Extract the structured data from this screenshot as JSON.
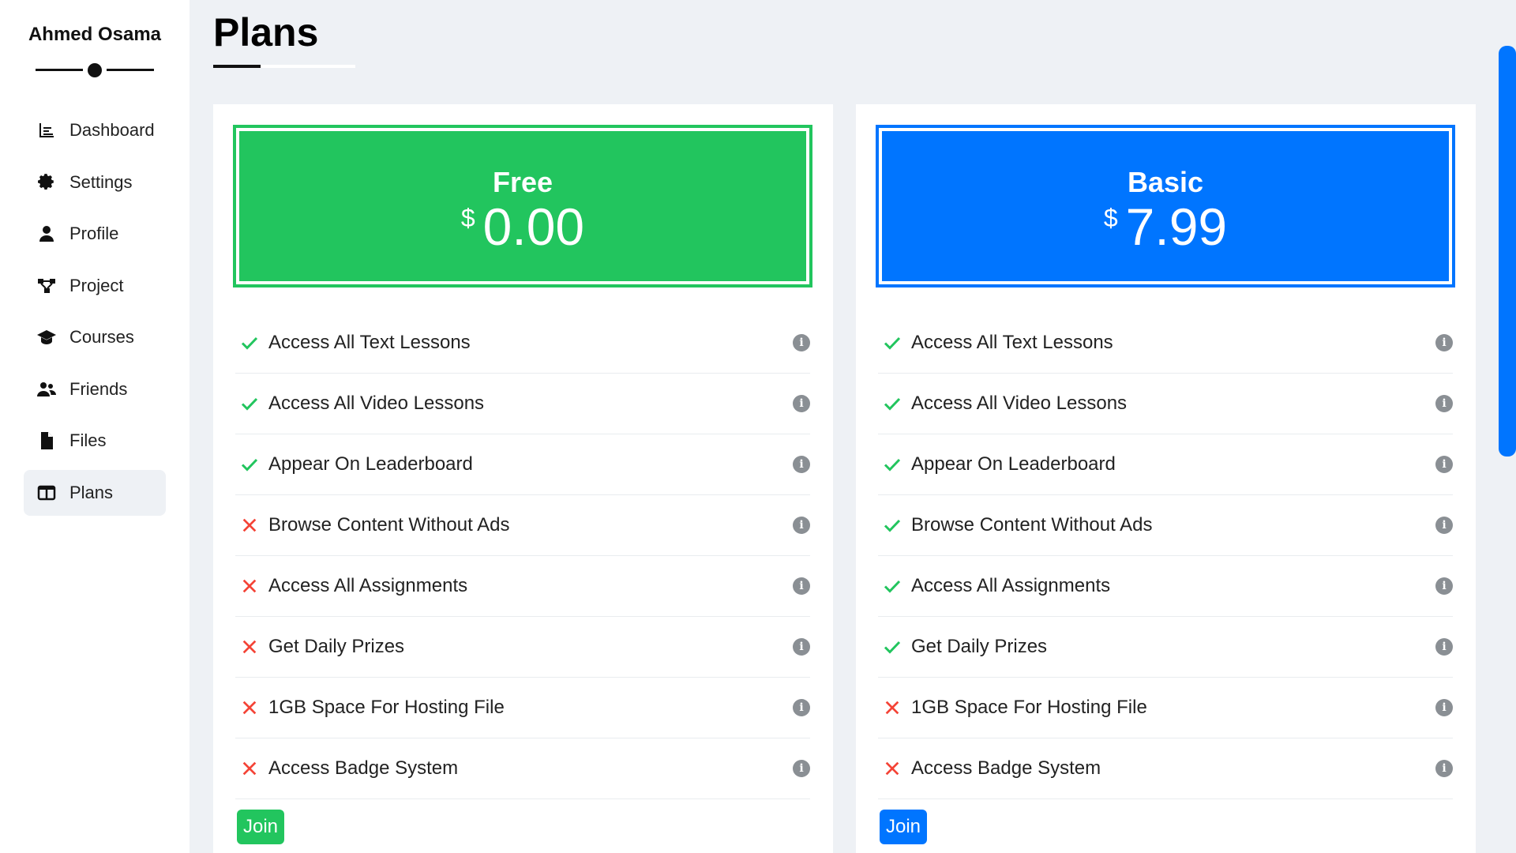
{
  "sidebar": {
    "brand": "Ahmed Osama",
    "items": [
      {
        "label": "Dashboard",
        "icon": "chart-icon"
      },
      {
        "label": "Settings",
        "icon": "gear-icon"
      },
      {
        "label": "Profile",
        "icon": "user-icon"
      },
      {
        "label": "Project",
        "icon": "diagram-icon"
      },
      {
        "label": "Courses",
        "icon": "graduation-cap-icon"
      },
      {
        "label": "Friends",
        "icon": "users-icon"
      },
      {
        "label": "Files",
        "icon": "file-icon"
      },
      {
        "label": "Plans",
        "icon": "table-columns-icon",
        "active": true
      }
    ]
  },
  "page": {
    "title": "Plans"
  },
  "colors": {
    "green": "#22c55e",
    "blue": "#0075ff",
    "red": "#f44336",
    "check": "#22c55e"
  },
  "plans": [
    {
      "name": "Free",
      "currency": "$",
      "price": "0.00",
      "color": "#22c55e",
      "join_label": "Join",
      "features": [
        {
          "label": "Access All Text Lessons",
          "included": true
        },
        {
          "label": "Access All Video Lessons",
          "included": true
        },
        {
          "label": "Appear On Leaderboard",
          "included": true
        },
        {
          "label": "Browse Content Without Ads",
          "included": false
        },
        {
          "label": "Access All Assignments",
          "included": false
        },
        {
          "label": "Get Daily Prizes",
          "included": false
        },
        {
          "label": "1GB Space For Hosting File",
          "included": false
        },
        {
          "label": "Access Badge System",
          "included": false
        }
      ]
    },
    {
      "name": "Basic",
      "currency": "$",
      "price": "7.99",
      "color": "#0075ff",
      "join_label": "Join",
      "features": [
        {
          "label": "Access All Text Lessons",
          "included": true
        },
        {
          "label": "Access All Video Lessons",
          "included": true
        },
        {
          "label": "Appear On Leaderboard",
          "included": true
        },
        {
          "label": "Browse Content Without Ads",
          "included": true
        },
        {
          "label": "Access All Assignments",
          "included": true
        },
        {
          "label": "Get Daily Prizes",
          "included": true
        },
        {
          "label": "1GB Space For Hosting File",
          "included": false
        },
        {
          "label": "Access Badge System",
          "included": false
        }
      ]
    }
  ]
}
